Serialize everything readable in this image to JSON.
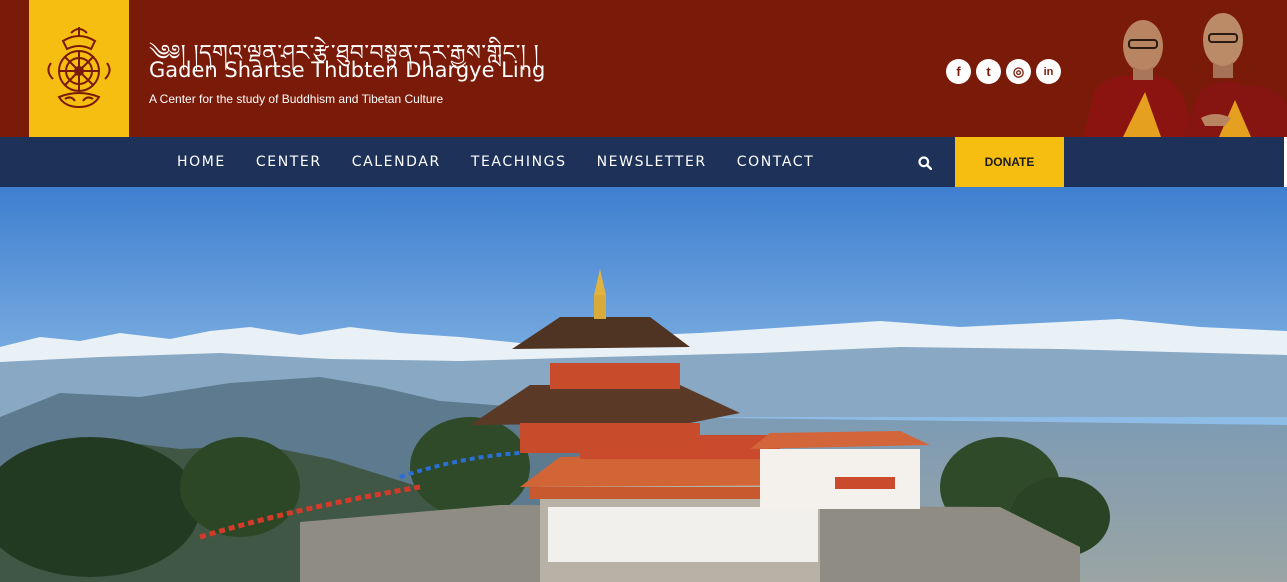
{
  "header": {
    "tibetan_title": "༄༅། །དགའ་ལྡན་ཤར་རྩེ་ཐུབ་བསྟན་དར་རྒྱས་གླིང་། །",
    "title": "Gaden Shartse Thubten Dhargye Ling",
    "tagline": "A Center for the study of Buddhism and Tibetan Culture",
    "logo_icon": "dharma-wheel-emblem",
    "brand_colors": {
      "maroon": "#7a1a08",
      "gold": "#f6be10",
      "navy": "#1e3259"
    }
  },
  "social": [
    {
      "name": "facebook-icon",
      "glyph": "f"
    },
    {
      "name": "twitter-icon",
      "glyph": "t"
    },
    {
      "name": "instagram-icon",
      "glyph": "◎"
    },
    {
      "name": "linkedin-icon",
      "glyph": "in"
    }
  ],
  "nav": {
    "items": [
      "HOME",
      "CENTER",
      "CALENDAR",
      "TEACHINGS",
      "NEWSLETTER",
      "CONTACT"
    ],
    "search_icon": "search-icon",
    "donate_label": "DONATE"
  }
}
